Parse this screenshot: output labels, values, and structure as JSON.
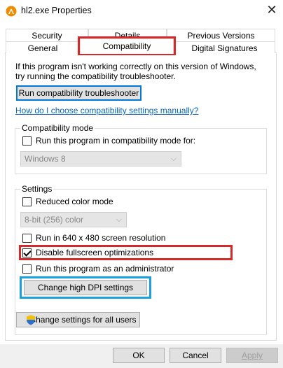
{
  "window": {
    "title": "hl2.exe Properties",
    "close_glyph": "✕",
    "icon": "half-life-lambda-icon"
  },
  "tabs": {
    "row1": [
      {
        "label": "Security"
      },
      {
        "label": "Details"
      },
      {
        "label": "Previous Versions"
      }
    ],
    "row2": [
      {
        "label": "General"
      },
      {
        "label": "Compatibility",
        "selected": true
      },
      {
        "label": "Digital Signatures"
      }
    ]
  },
  "intro": {
    "line1": "If this program isn't working correctly on this version of Windows,",
    "line2": "try running the compatibility troubleshooter."
  },
  "buttons": {
    "troubleshooter": "Run compatibility troubleshooter",
    "change_dpi": "Change high DPI settings",
    "change_all_users": "Change settings for all users",
    "ok": "OK",
    "cancel": "Cancel",
    "apply": "Apply"
  },
  "link": {
    "manual": "How do I choose compatibility settings manually?"
  },
  "compat_mode": {
    "label": "Compatibility mode",
    "checkbox_label": "Run this program in compatibility mode for:",
    "checked": false,
    "select_value": "Windows 8"
  },
  "settings": {
    "label": "Settings",
    "reduced_color": {
      "label": "Reduced color mode",
      "checked": false
    },
    "color_select_value": "8-bit (256) color",
    "run_640": {
      "label": "Run in 640 x 480 screen resolution",
      "checked": false
    },
    "disable_fullscreen": {
      "label": "Disable fullscreen optimizations",
      "checked": true
    },
    "run_admin": {
      "label": "Run this program as an administrator",
      "checked": false
    }
  },
  "colors": {
    "highlight_red": "#d42a2a",
    "highlight_blue": "#1aa0de",
    "link": "#0a66c2"
  }
}
